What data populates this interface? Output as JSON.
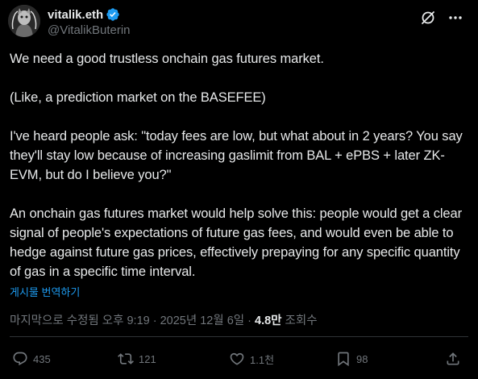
{
  "author": {
    "display_name": "vitalik.eth",
    "handle": "@VitalikButerin",
    "verified": true,
    "verified_color": "#1d9bf0"
  },
  "header_icons": {
    "grok": "grok-icon",
    "more": "more-options-icon"
  },
  "tweet": {
    "paragraphs": [
      "We need a good trustless onchain gas futures market.",
      "(Like, a prediction market on the BASEFEE)",
      "I've heard people ask: \"today fees are low, but what about in 2 years? You say they'll stay low because of increasing gaslimit from BAL + ePBS + later ZK-EVM, but do I believe you?\"",
      "An onchain gas futures market would help solve this: people would get a clear signal of people's expectations of future gas fees, and would even be able to hedge against future gas prices, effectively prepaying for any specific quantity of gas in a specific time interval."
    ],
    "translate_label": "게시물 번역하기"
  },
  "meta": {
    "edited_time": "마지막으로 수정됨 오후 9:19 · 2025년 12월 6일 · ",
    "views_count": "4.8만",
    "views_label": " 조회수"
  },
  "actions": {
    "reply_count": "435",
    "retweet_count": "121",
    "like_count": "1.1천",
    "bookmark_count": "98"
  },
  "colors": {
    "background": "#000000",
    "text": "#e7e9ea",
    "secondary": "#71767b",
    "accent": "#1d9bf0",
    "divider": "#2f3336"
  }
}
